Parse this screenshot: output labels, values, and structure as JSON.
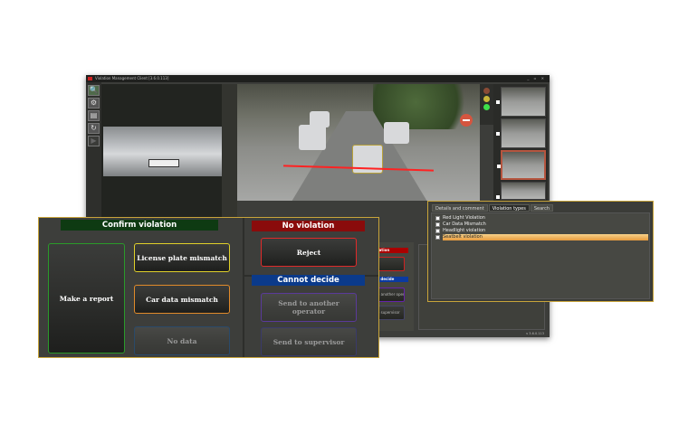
{
  "window": {
    "title": "Violation Management Client  [3.6.0.113]",
    "controls": "_ ▫ ✕",
    "version": "v 3.6.0.113"
  },
  "toolbar": {
    "icons": [
      "search-document-icon",
      "settings-gear-icon",
      "list-icon",
      "refresh-icon",
      "play-icon"
    ],
    "glyphs": [
      "🔍",
      "⚙",
      "▤",
      "↻",
      "▶"
    ]
  },
  "traffic_light": {
    "colors": [
      "#8a4b35",
      "#c9b63a",
      "#3ee04a"
    ]
  },
  "background_panel": {
    "no_violation": "No violation",
    "reject": "Reject",
    "cannot_decide": "Cannot decide",
    "send_operator": "Send to another operator",
    "send_supervisor": "Send to supervisor"
  },
  "decision_panel": {
    "confirm_header": "Confirm violation",
    "confirm_color": "#0e3a12",
    "make_report": "Make a report",
    "license_plate_mismatch": "License plate mismatch",
    "car_data_mismatch": "Car data mismatch",
    "no_data": "No data",
    "no_violation_header": "No violation",
    "no_violation_color": "#8a0b0b",
    "reject": "Reject",
    "cannot_decide_header": "Cannot decide",
    "cannot_decide_color": "#0b3a8a",
    "send_operator": "Send to another operator",
    "send_supervisor": "Send to supervisor"
  },
  "violation_panel": {
    "tabs": [
      {
        "label": "Details and comment",
        "active": false
      },
      {
        "label": "Violation types",
        "active": true
      },
      {
        "label": "Search",
        "active": false
      }
    ],
    "items": [
      {
        "label": "Red Light Violation",
        "checked": false,
        "selected": false
      },
      {
        "label": "Car Data Mismatch",
        "checked": false,
        "selected": false
      },
      {
        "label": "Headlight violation",
        "checked": false,
        "selected": false
      },
      {
        "label": "Seatbelt violation",
        "checked": false,
        "selected": true
      }
    ]
  }
}
